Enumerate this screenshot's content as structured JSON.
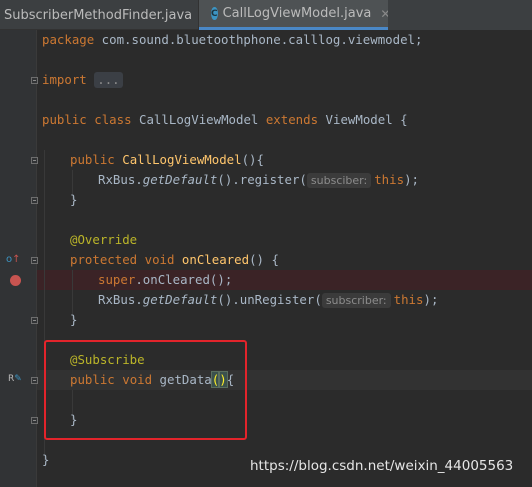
{
  "tabs": [
    {
      "label": "SubscriberMethodFinder.java",
      "close": "✕",
      "active": false
    },
    {
      "label": "CallLogViewModel.java",
      "close": "✕",
      "active": true,
      "icon_letter": "C"
    }
  ],
  "code": {
    "l1_kw": "package",
    "l1_pkg": " com.sound.bluetoothphone.calllog.viewmodel;",
    "l2_kw": "import",
    "l2_fold": "...",
    "l3_public": "public",
    "l3_class": "class",
    "l3_name": "CallLogViewModel",
    "l3_extends": "extends",
    "l3_rest": "ViewModel {",
    "l4_public": "public",
    "l4_name": "CallLogViewModel",
    "l4_rest": "(){",
    "l5_a": "RxBus.",
    "l5_method": "getDefault",
    "l5_b": "().register(",
    "l5_hint": "subsciber:",
    "l5_this": "this",
    "l5_c": ");",
    "l6": "}",
    "l7_ann": "@Override",
    "l8_protected": "protected",
    "l8_void": "void",
    "l8_name": "onCleared",
    "l8_rest": "() {",
    "l9_super": "super",
    "l9_rest": ".onCleared();",
    "l10_a": "RxBus.",
    "l10_method": "getDefault",
    "l10_b": "().unRegister(",
    "l10_hint": "subscriber:",
    "l10_this": "this",
    "l10_c": ");",
    "l11": "}",
    "l12_ann": "@Subscribe",
    "l13_public": "public",
    "l13_void": "void",
    "l13_name": "getData",
    "l13_paren_open": "(",
    "l13_paren_close": ")",
    "l13_brace": "{",
    "l14": "}",
    "l15": "}"
  },
  "watermark": "https://blog.csdn.net/weixin_44005563",
  "colors": {
    "background": "#2b2b2b",
    "keyword": "#cc7832",
    "method": "#ffc66d",
    "annotation": "#bbb529",
    "breakpoint": "#c75450",
    "highlight_box": "#e3242b"
  },
  "icons": {
    "override": "override-gutter-icon",
    "breakpoint": "breakpoint-icon",
    "subscribe": "subscriber-method-gutter-icon"
  }
}
